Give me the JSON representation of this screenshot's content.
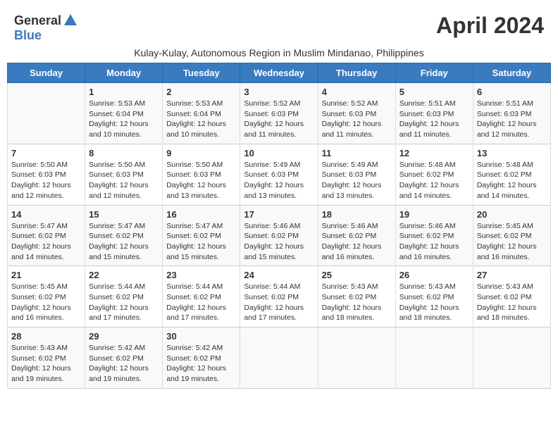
{
  "header": {
    "logo_general": "General",
    "logo_blue": "Blue",
    "title": "April 2024",
    "subtitle": "Kulay-Kulay, Autonomous Region in Muslim Mindanao, Philippines"
  },
  "days_of_week": [
    "Sunday",
    "Monday",
    "Tuesday",
    "Wednesday",
    "Thursday",
    "Friday",
    "Saturday"
  ],
  "weeks": [
    [
      {
        "day": "",
        "sunrise": "",
        "sunset": "",
        "daylight": ""
      },
      {
        "day": "1",
        "sunrise": "Sunrise: 5:53 AM",
        "sunset": "Sunset: 6:04 PM",
        "daylight": "Daylight: 12 hours and 10 minutes."
      },
      {
        "day": "2",
        "sunrise": "Sunrise: 5:53 AM",
        "sunset": "Sunset: 6:04 PM",
        "daylight": "Daylight: 12 hours and 10 minutes."
      },
      {
        "day": "3",
        "sunrise": "Sunrise: 5:52 AM",
        "sunset": "Sunset: 6:03 PM",
        "daylight": "Daylight: 12 hours and 11 minutes."
      },
      {
        "day": "4",
        "sunrise": "Sunrise: 5:52 AM",
        "sunset": "Sunset: 6:03 PM",
        "daylight": "Daylight: 12 hours and 11 minutes."
      },
      {
        "day": "5",
        "sunrise": "Sunrise: 5:51 AM",
        "sunset": "Sunset: 6:03 PM",
        "daylight": "Daylight: 12 hours and 11 minutes."
      },
      {
        "day": "6",
        "sunrise": "Sunrise: 5:51 AM",
        "sunset": "Sunset: 6:03 PM",
        "daylight": "Daylight: 12 hours and 12 minutes."
      }
    ],
    [
      {
        "day": "7",
        "sunrise": "Sunrise: 5:50 AM",
        "sunset": "Sunset: 6:03 PM",
        "daylight": "Daylight: 12 hours and 12 minutes."
      },
      {
        "day": "8",
        "sunrise": "Sunrise: 5:50 AM",
        "sunset": "Sunset: 6:03 PM",
        "daylight": "Daylight: 12 hours and 12 minutes."
      },
      {
        "day": "9",
        "sunrise": "Sunrise: 5:50 AM",
        "sunset": "Sunset: 6:03 PM",
        "daylight": "Daylight: 12 hours and 13 minutes."
      },
      {
        "day": "10",
        "sunrise": "Sunrise: 5:49 AM",
        "sunset": "Sunset: 6:03 PM",
        "daylight": "Daylight: 12 hours and 13 minutes."
      },
      {
        "day": "11",
        "sunrise": "Sunrise: 5:49 AM",
        "sunset": "Sunset: 6:03 PM",
        "daylight": "Daylight: 12 hours and 13 minutes."
      },
      {
        "day": "12",
        "sunrise": "Sunrise: 5:48 AM",
        "sunset": "Sunset: 6:02 PM",
        "daylight": "Daylight: 12 hours and 14 minutes."
      },
      {
        "day": "13",
        "sunrise": "Sunrise: 5:48 AM",
        "sunset": "Sunset: 6:02 PM",
        "daylight": "Daylight: 12 hours and 14 minutes."
      }
    ],
    [
      {
        "day": "14",
        "sunrise": "Sunrise: 5:47 AM",
        "sunset": "Sunset: 6:02 PM",
        "daylight": "Daylight: 12 hours and 14 minutes."
      },
      {
        "day": "15",
        "sunrise": "Sunrise: 5:47 AM",
        "sunset": "Sunset: 6:02 PM",
        "daylight": "Daylight: 12 hours and 15 minutes."
      },
      {
        "day": "16",
        "sunrise": "Sunrise: 5:47 AM",
        "sunset": "Sunset: 6:02 PM",
        "daylight": "Daylight: 12 hours and 15 minutes."
      },
      {
        "day": "17",
        "sunrise": "Sunrise: 5:46 AM",
        "sunset": "Sunset: 6:02 PM",
        "daylight": "Daylight: 12 hours and 15 minutes."
      },
      {
        "day": "18",
        "sunrise": "Sunrise: 5:46 AM",
        "sunset": "Sunset: 6:02 PM",
        "daylight": "Daylight: 12 hours and 16 minutes."
      },
      {
        "day": "19",
        "sunrise": "Sunrise: 5:46 AM",
        "sunset": "Sunset: 6:02 PM",
        "daylight": "Daylight: 12 hours and 16 minutes."
      },
      {
        "day": "20",
        "sunrise": "Sunrise: 5:45 AM",
        "sunset": "Sunset: 6:02 PM",
        "daylight": "Daylight: 12 hours and 16 minutes."
      }
    ],
    [
      {
        "day": "21",
        "sunrise": "Sunrise: 5:45 AM",
        "sunset": "Sunset: 6:02 PM",
        "daylight": "Daylight: 12 hours and 16 minutes."
      },
      {
        "day": "22",
        "sunrise": "Sunrise: 5:44 AM",
        "sunset": "Sunset: 6:02 PM",
        "daylight": "Daylight: 12 hours and 17 minutes."
      },
      {
        "day": "23",
        "sunrise": "Sunrise: 5:44 AM",
        "sunset": "Sunset: 6:02 PM",
        "daylight": "Daylight: 12 hours and 17 minutes."
      },
      {
        "day": "24",
        "sunrise": "Sunrise: 5:44 AM",
        "sunset": "Sunset: 6:02 PM",
        "daylight": "Daylight: 12 hours and 17 minutes."
      },
      {
        "day": "25",
        "sunrise": "Sunrise: 5:43 AM",
        "sunset": "Sunset: 6:02 PM",
        "daylight": "Daylight: 12 hours and 18 minutes."
      },
      {
        "day": "26",
        "sunrise": "Sunrise: 5:43 AM",
        "sunset": "Sunset: 6:02 PM",
        "daylight": "Daylight: 12 hours and 18 minutes."
      },
      {
        "day": "27",
        "sunrise": "Sunrise: 5:43 AM",
        "sunset": "Sunset: 6:02 PM",
        "daylight": "Daylight: 12 hours and 18 minutes."
      }
    ],
    [
      {
        "day": "28",
        "sunrise": "Sunrise: 5:43 AM",
        "sunset": "Sunset: 6:02 PM",
        "daylight": "Daylight: 12 hours and 19 minutes."
      },
      {
        "day": "29",
        "sunrise": "Sunrise: 5:42 AM",
        "sunset": "Sunset: 6:02 PM",
        "daylight": "Daylight: 12 hours and 19 minutes."
      },
      {
        "day": "30",
        "sunrise": "Sunrise: 5:42 AM",
        "sunset": "Sunset: 6:02 PM",
        "daylight": "Daylight: 12 hours and 19 minutes."
      },
      {
        "day": "",
        "sunrise": "",
        "sunset": "",
        "daylight": ""
      },
      {
        "day": "",
        "sunrise": "",
        "sunset": "",
        "daylight": ""
      },
      {
        "day": "",
        "sunrise": "",
        "sunset": "",
        "daylight": ""
      },
      {
        "day": "",
        "sunrise": "",
        "sunset": "",
        "daylight": ""
      }
    ]
  ]
}
